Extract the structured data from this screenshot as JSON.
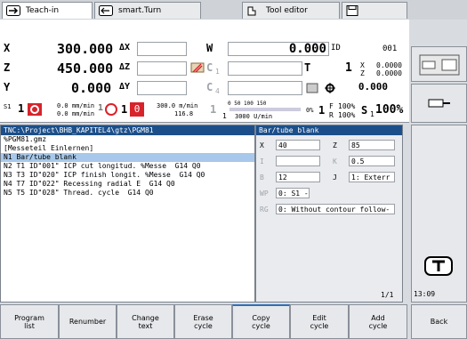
{
  "tabs": [
    {
      "label": "Teach-in",
      "icon": "teach-in-icon"
    },
    {
      "label": "smart.Turn",
      "icon": "smart-turn-icon"
    },
    {
      "label": "Tool editor",
      "icon": "tool-editor-icon"
    },
    {
      "label": "",
      "icon": "save-icon"
    }
  ],
  "status": {
    "x_label": "X",
    "x_value": "300.000",
    "x_delta": "ΔX",
    "z_label": "Z",
    "z_value": "450.000",
    "z_delta": "ΔZ",
    "y_label": "Y",
    "y_value": "0.000",
    "y_delta": "ΔY",
    "w_label": "W",
    "w_value": "0.000",
    "id_label": "ID",
    "id_value": "001",
    "c1_label": "C",
    "c1_sub": "1",
    "c4_label": "C",
    "c4_sub": "4",
    "t_label": "T",
    "t_value": "1",
    "tx_label": "X",
    "tx_value": "0.0000",
    "tz_label": "Z",
    "tz_value": "0.0000",
    "spindle_value": "0.000",
    "s1_prefix": "S1",
    "s1_num": "1",
    "feed_top": "0.0 mm/min",
    "feed_bottom": "0.0 mm/min",
    "feed_num": "1",
    "speed_top": "300.0 m/min",
    "speed_bottom": "116.8",
    "speed_num": "1",
    "speed_zero": "0",
    "gauge_ticks": "0    50   100  150",
    "gauge_value": "3000 U/min",
    "gauge_pct": "0%",
    "s_big": "1",
    "s_sub1": "1",
    "s_sub0": "0",
    "f_label": "F",
    "f_pct": "100%",
    "r_label": "R",
    "r_pct": "100%",
    "s1_label": "S",
    "s1_sub": "1",
    "s1_pct": "100%"
  },
  "program": {
    "path": "TNC:\\Project\\BHB_KAPITEL4\\gtz\\PGM81",
    "lines": [
      "%PGM81.gmz",
      "[Messeteil Einlernen]",
      "N1 Bar/tube blank",
      "N2 T1 ID\"001\" ICP cut longitud. %Messe  G14 Q0",
      "N3 T3 ID\"020\" ICP finish longit. %Messe  G14 Q0",
      "N4 T7 ID\"022\" Recessing radial E  G14 Q0",
      "N5 T5 ID\"028\" Thread. cycle  G14 Q0"
    ],
    "selected_index": 2
  },
  "form": {
    "title": "Bar/tube blank",
    "x_label": "X",
    "x_value": "40",
    "z_label": "Z",
    "z_value": "85",
    "i_label": "I",
    "i_value": "",
    "k_label": "K",
    "k_value": "0.5",
    "b_label": "B",
    "b_value": "12",
    "j_label": "J",
    "j_value": "1: Exterr",
    "wp_label": "WP",
    "wp_value": "0: S1 -",
    "rg_label": "RG",
    "rg_value": "0: Without contour follow-",
    "page": "1/1"
  },
  "clock": "13:09",
  "softkeys_bottom": [
    {
      "label": "Program\nlist"
    },
    {
      "label": "Renumber"
    },
    {
      "label": "Change\ntext"
    },
    {
      "label": "Erase\ncycle"
    },
    {
      "label": "Copy\ncycle"
    },
    {
      "label": "Edit\ncycle"
    },
    {
      "label": "Add\ncycle"
    },
    {
      "label": "Back"
    }
  ],
  "colors": {
    "header_blue": "#1c4f8a",
    "selection": "#a7c8ea",
    "alert_red": "#d8232a",
    "softkey_active": "#2f6fb8"
  }
}
